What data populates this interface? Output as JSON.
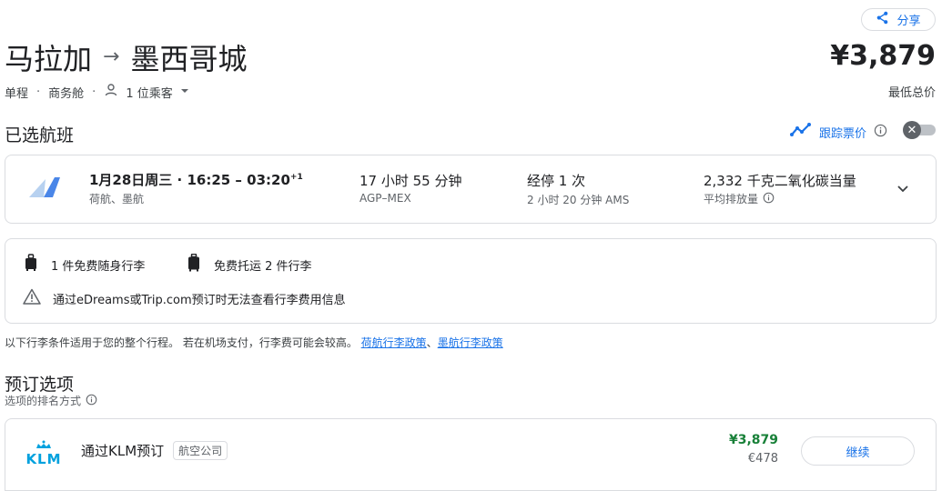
{
  "header": {
    "share_label": "分享",
    "origin": "马拉加",
    "destination": "墨西哥城",
    "price": "¥3,879",
    "price_caption": "最低总价",
    "trip_type": "单程",
    "cabin": "商务舱",
    "passengers": "1 位乘客"
  },
  "selected": {
    "heading": "已选航班",
    "track_label": "跟踪票价",
    "flight": {
      "date_time": "1月28日周三 · 16:25 – 03:20",
      "day_offset": "+1",
      "airlines": "荷航、墨航",
      "duration": "17 小时 55 分钟",
      "route": "AGP–MEX",
      "stops": "经停 1 次",
      "layover": "2 小时 20 分钟 AMS",
      "emissions": "2,332 千克二氧化碳当量",
      "emissions_caption": "平均排放量"
    }
  },
  "baggage": {
    "carry_on": "1 件免费随身行李",
    "checked": "免费托运 2 件行李",
    "warning": "通过eDreams或Trip.com预订时无法查看行李费用信息",
    "note": "以下行李条件适用于您的整个行程。 若在机场支付，行李费可能会较高。",
    "link1": "荷航行李政策",
    "separator": "、",
    "link2": "墨航行李政策"
  },
  "booking": {
    "heading": "预订选项",
    "sort_caption": "选项的排名方式",
    "option": {
      "logo_text": "KLM",
      "label": "通过KLM预订",
      "tag": "航空公司",
      "price": "¥3,879",
      "price_eur": "€478",
      "continue_label": "继续"
    }
  },
  "colors": {
    "accent": "#1a73e8",
    "price_green": "#188038",
    "klm_blue": "#00a1de"
  }
}
